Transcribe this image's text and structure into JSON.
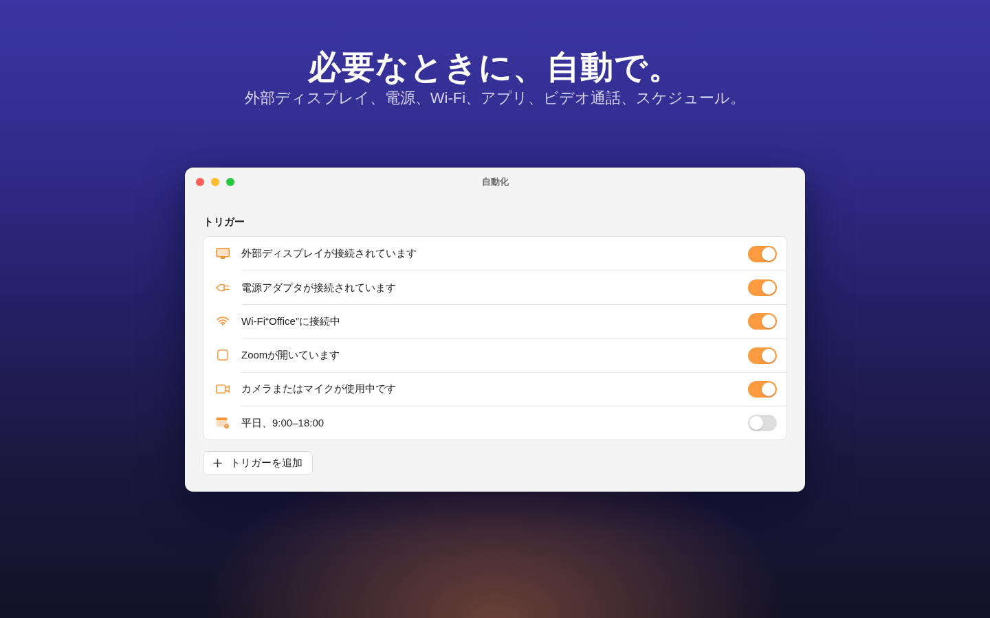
{
  "hero": {
    "title": "必要なときに、自動で。",
    "subtitle": "外部ディスプレイ、電源、Wi-Fi、アプリ、ビデオ通話、スケジュール。"
  },
  "window": {
    "title": "自動化"
  },
  "section": {
    "label": "トリガー"
  },
  "triggers": [
    {
      "kind": "display",
      "label": "外部ディスプレイが接続されています",
      "on": true
    },
    {
      "kind": "power",
      "label": "電源アダプタが接続されています",
      "on": true
    },
    {
      "kind": "wifi",
      "label": "Wi-Fi“Office”に接続中",
      "on": true
    },
    {
      "kind": "app",
      "label": "Zoomが開いています",
      "on": true
    },
    {
      "kind": "camera",
      "label": "カメラまたはマイクが使用中です",
      "on": true
    },
    {
      "kind": "schedule",
      "label": "平日、9:00–18:00",
      "on": false
    }
  ],
  "add_button": {
    "label": "トリガーを追加"
  }
}
